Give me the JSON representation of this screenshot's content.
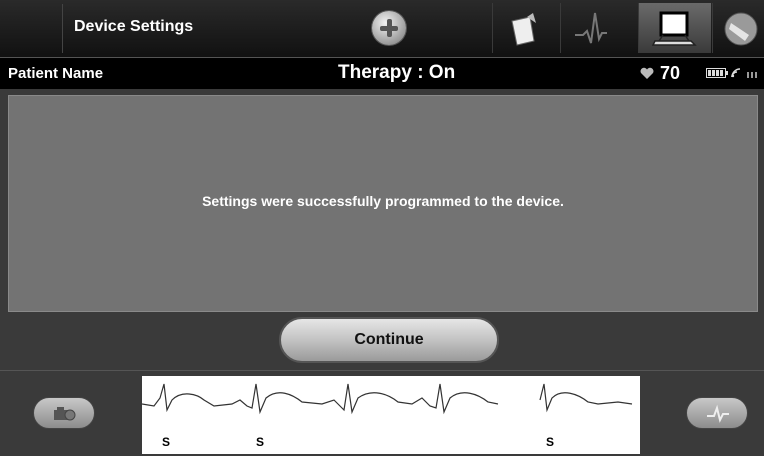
{
  "header": {
    "title": "Device Settings"
  },
  "nav_tabs": [
    {
      "icon": "clipboard-icon"
    },
    {
      "icon": "ecg-wave-icon"
    },
    {
      "icon": "laptop-icon"
    },
    {
      "icon": "wand-icon"
    }
  ],
  "status": {
    "patient": "Patient Name",
    "therapy": "Therapy : On",
    "heart_rate": "70"
  },
  "message": "Settings were successfully programmed to the device.",
  "continue_label": "Continue",
  "ecg": {
    "markers": [
      "S",
      "S",
      "S"
    ]
  }
}
